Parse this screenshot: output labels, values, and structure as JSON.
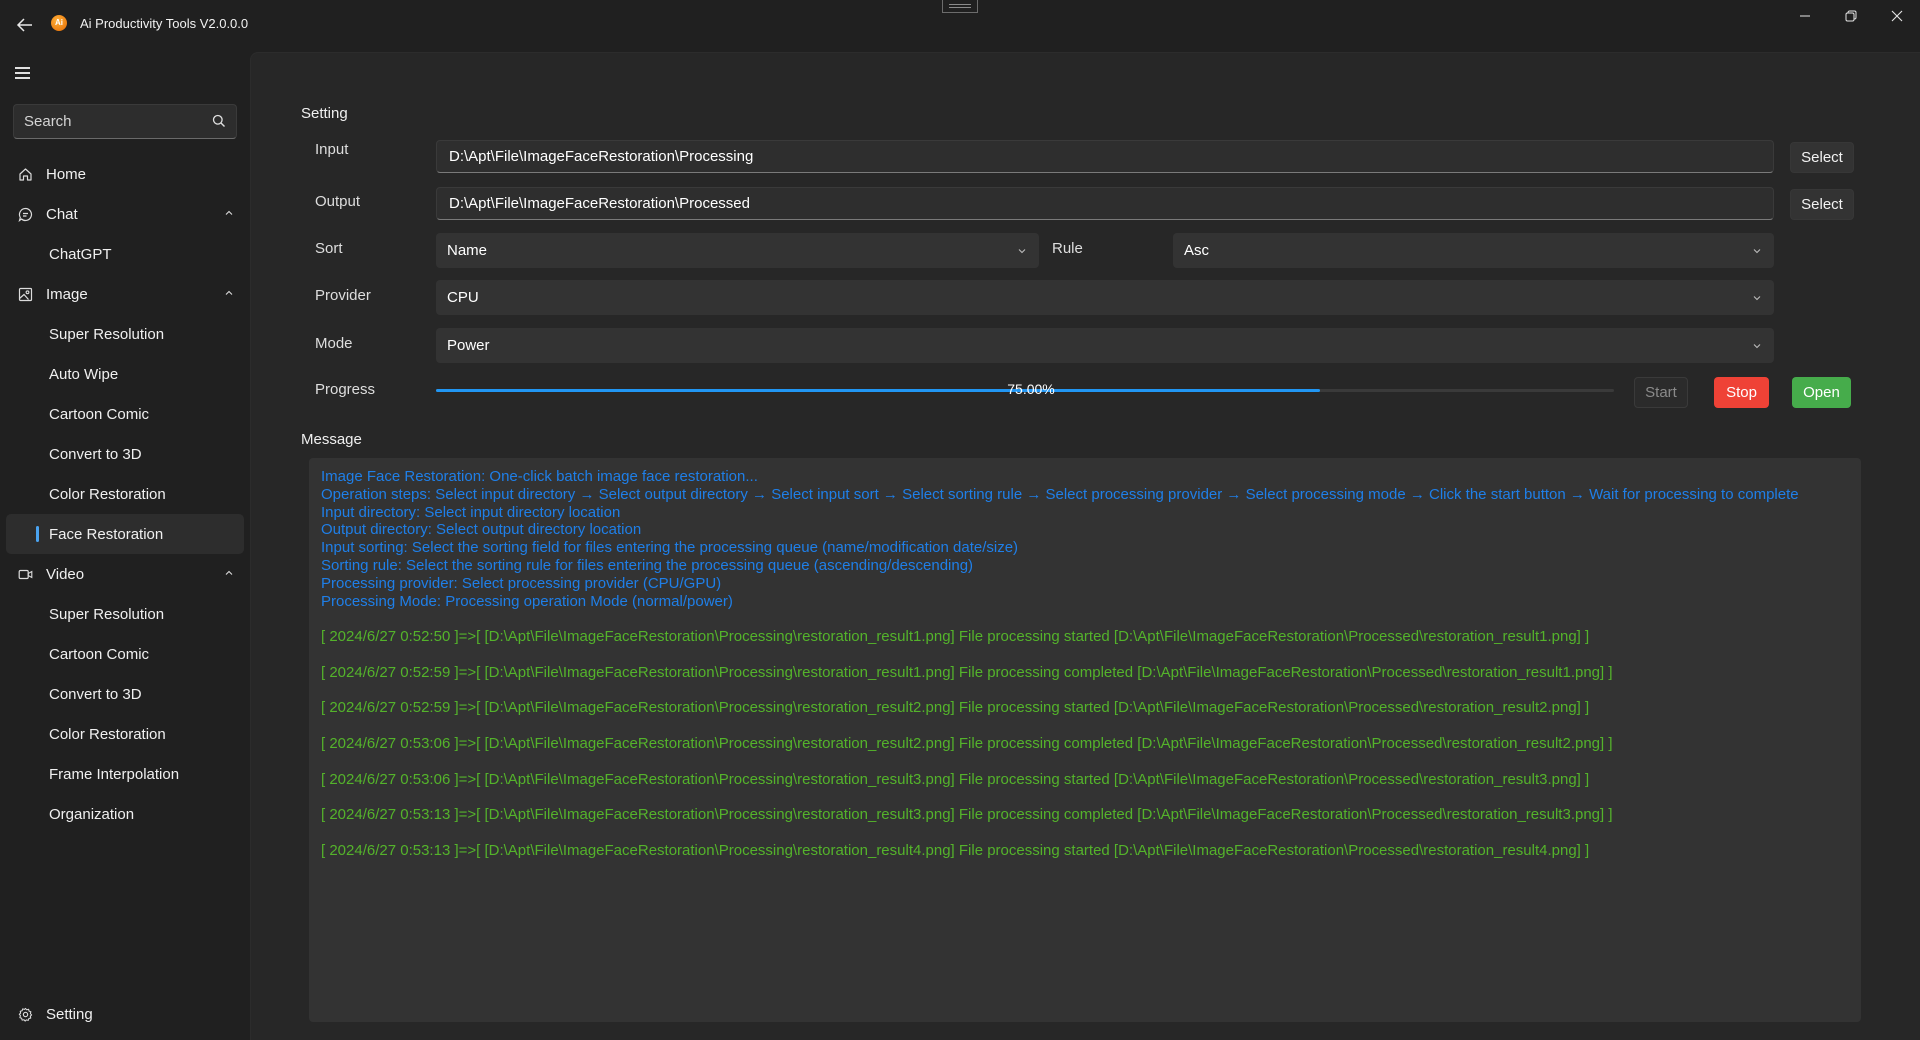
{
  "window": {
    "title": "Ai Productivity Tools V2.0.0.0",
    "logo_text": "Ai",
    "controls": [
      "minimize-icon",
      "restore-icon",
      "close-icon"
    ]
  },
  "sidebar": {
    "search_placeholder": "Search",
    "items": [
      {
        "label": "Home",
        "icon": "home-icon",
        "level": 0
      },
      {
        "label": "Chat",
        "icon": "chat-icon",
        "level": 0,
        "expanded": true
      },
      {
        "label": "ChatGPT",
        "level": 1
      },
      {
        "label": "Image",
        "icon": "image-icon",
        "level": 0,
        "expanded": true
      },
      {
        "label": "Super Resolution",
        "level": 1
      },
      {
        "label": "Auto Wipe",
        "level": 1
      },
      {
        "label": "Cartoon Comic",
        "level": 1
      },
      {
        "label": "Convert to 3D",
        "level": 1
      },
      {
        "label": "Color Restoration",
        "level": 1
      },
      {
        "label": "Face Restoration",
        "level": 1,
        "active": true
      },
      {
        "label": "Video",
        "icon": "video-icon",
        "level": 0,
        "expanded": true
      },
      {
        "label": "Super Resolution",
        "level": 1
      },
      {
        "label": "Cartoon Comic",
        "level": 1
      },
      {
        "label": "Convert to 3D",
        "level": 1
      },
      {
        "label": "Color Restoration",
        "level": 1
      },
      {
        "label": "Frame Interpolation",
        "level": 1
      },
      {
        "label": "Organization",
        "level": 1
      }
    ],
    "footer": {
      "label": "Setting",
      "icon": "gear-icon"
    }
  },
  "setting": {
    "title": "Setting",
    "input": {
      "label": "Input",
      "value": "D:\\Apt\\File\\ImageFaceRestoration\\Processing",
      "button": "Select"
    },
    "output": {
      "label": "Output",
      "value": "D:\\Apt\\File\\ImageFaceRestoration\\Processed",
      "button": "Select"
    },
    "sort": {
      "label": "Sort",
      "value": "Name"
    },
    "rule": {
      "label": "Rule",
      "value": "Asc"
    },
    "provider": {
      "label": "Provider",
      "value": "CPU"
    },
    "mode": {
      "label": "Mode",
      "value": "Power"
    },
    "progress": {
      "label": "Progress",
      "value": 0.75,
      "text": "75.00%"
    },
    "buttons": {
      "start": "Start",
      "stop": "Stop",
      "open": "Open"
    }
  },
  "message": {
    "title": "Message",
    "info_lines": [
      "Image Face Restoration: One-click batch image face restoration...",
      "Operation steps: Select input directory → Select output directory → Select input sort → Select sorting rule → Select processing provider → Select processing mode → Click the start button → Wait for processing to complete",
      "Input directory: Select input directory location",
      "Output directory: Select output directory location",
      "Input sorting: Select the sorting field for files entering the processing queue (name/modification date/size)",
      "Sorting rule: Select the sorting rule for files entering the processing queue (ascending/descending)",
      "Processing provider: Select processing provider (CPU/GPU)",
      "Processing Mode: Processing operation Mode (normal/power)"
    ],
    "log_lines": [
      "[ 2024/6/27 0:52:50 ]=>[ [D:\\Apt\\File\\ImageFaceRestoration\\Processing\\restoration_result1.png] File processing started [D:\\Apt\\File\\ImageFaceRestoration\\Processed\\restoration_result1.png] ]",
      "[ 2024/6/27 0:52:59 ]=>[ [D:\\Apt\\File\\ImageFaceRestoration\\Processing\\restoration_result1.png] File processing completed [D:\\Apt\\File\\ImageFaceRestoration\\Processed\\restoration_result1.png] ]",
      "[ 2024/6/27 0:52:59 ]=>[ [D:\\Apt\\File\\ImageFaceRestoration\\Processing\\restoration_result2.png] File processing started [D:\\Apt\\File\\ImageFaceRestoration\\Processed\\restoration_result2.png] ]",
      "[ 2024/6/27 0:53:06 ]=>[ [D:\\Apt\\File\\ImageFaceRestoration\\Processing\\restoration_result2.png] File processing completed [D:\\Apt\\File\\ImageFaceRestoration\\Processed\\restoration_result2.png] ]",
      "[ 2024/6/27 0:53:06 ]=>[ [D:\\Apt\\File\\ImageFaceRestoration\\Processing\\restoration_result3.png] File processing started [D:\\Apt\\File\\ImageFaceRestoration\\Processed\\restoration_result3.png] ]",
      "[ 2024/6/27 0:53:13 ]=>[ [D:\\Apt\\File\\ImageFaceRestoration\\Processing\\restoration_result3.png] File processing completed [D:\\Apt\\File\\ImageFaceRestoration\\Processed\\restoration_result3.png] ]",
      "[ 2024/6/27 0:53:13 ]=>[ [D:\\Apt\\File\\ImageFaceRestoration\\Processing\\restoration_result4.png] File processing started [D:\\Apt\\File\\ImageFaceRestoration\\Processed\\restoration_result4.png] ]"
    ]
  },
  "colors": {
    "accent": "#2196f3",
    "info_text": "#1f7fe8",
    "log_text": "#54b32b",
    "stop": "#ef4236",
    "open": "#46ac4b"
  }
}
